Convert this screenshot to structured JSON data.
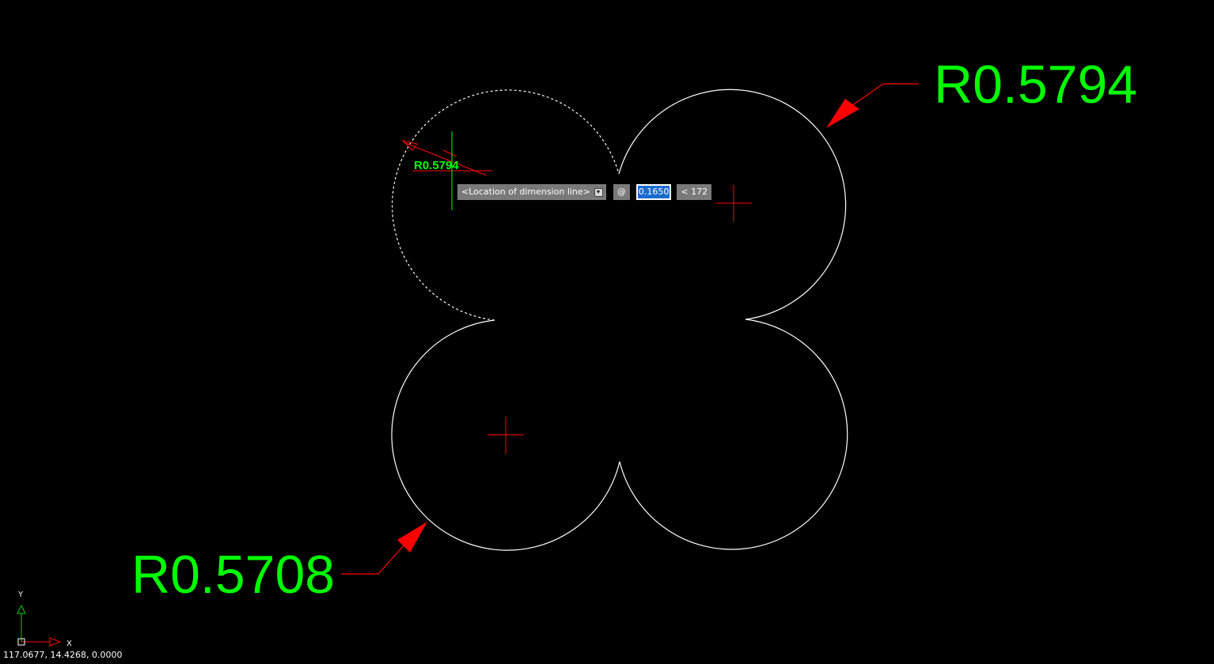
{
  "dimensions": {
    "top_right_label": "R0.5794",
    "bottom_left_label": "R0.5708",
    "preview_label": "R0.5794"
  },
  "dynamic_input": {
    "prompt": "<Location of dimension line>",
    "dropdown_icon": "dropdown-arrow-icon",
    "relative_symbol": "@",
    "distance_value": "0.1650",
    "angle_value": "< 172"
  },
  "status": {
    "coordinates": "117.0677, 14.4268, 0.0000"
  },
  "ucs": {
    "x_label": "X",
    "y_label": "Y"
  },
  "colors": {
    "background": "#000000",
    "geometry": "#ffffff",
    "dimension_text": "#00ff00",
    "leader": "#ff0000",
    "center_mark": "#ff0000",
    "cursor_vertical": "#00ff00",
    "input_highlight": "#1a6bd0"
  }
}
